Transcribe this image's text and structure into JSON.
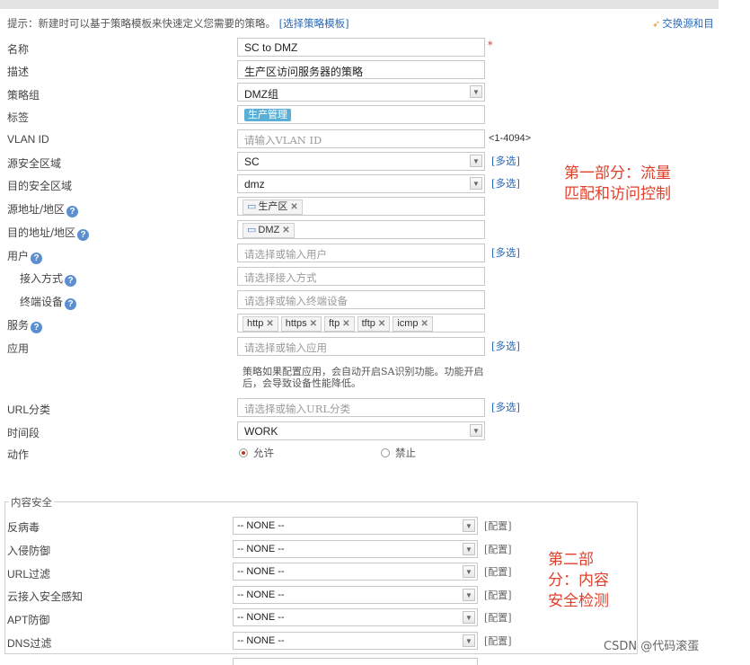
{
  "tip": {
    "text": "提示：新建时可以基于策略模板来快速定义您需要的策略。",
    "link": "[选择策略模板]"
  },
  "swap_label": "交换源和目",
  "form": {
    "name": {
      "label": "名称",
      "value": "SC to DMZ",
      "required_mark": "*"
    },
    "description": {
      "label": "描述",
      "value": "生产区访问服务器的策略"
    },
    "policy_group": {
      "label": "策略组",
      "value": "DMZ组"
    },
    "tags": {
      "label": "标签",
      "value": "生产管理"
    },
    "vlan": {
      "label": "VLAN ID",
      "placeholder": "请输入VLAN ID",
      "range": "<1-4094>"
    },
    "src_zone": {
      "label": "源安全区域",
      "value": "SC",
      "multi": "[多选]"
    },
    "dst_zone": {
      "label": "目的安全区域",
      "value": "dmz",
      "multi": "[多选]"
    },
    "src_addr": {
      "label": "源地址/地区",
      "chip": "生产区"
    },
    "dst_addr": {
      "label": "目的地址/地区",
      "chip": "DMZ"
    },
    "user": {
      "label": "用户",
      "placeholder": "请选择或输入用户",
      "multi": "[多选]"
    },
    "access_mode": {
      "label": "接入方式",
      "placeholder": "请选择接入方式"
    },
    "terminal": {
      "label": "终端设备",
      "placeholder": "请选择或输入终端设备"
    },
    "service": {
      "label": "服务",
      "chips": [
        "http",
        "https",
        "ftp",
        "tftp",
        "icmp"
      ]
    },
    "application": {
      "label": "应用",
      "placeholder": "请选择或输入应用",
      "multi": "[多选]",
      "note": "策略如果配置应用，会自动开启SA识别功能。功能开启后，会导致设备性能降低。"
    },
    "url_category": {
      "label": "URL分类",
      "placeholder": "请选择或输入URL分类",
      "multi": "[多选]"
    },
    "time_range": {
      "label": "时间段",
      "value": "WORK"
    },
    "action": {
      "label": "动作",
      "allow": "允许",
      "deny": "禁止"
    }
  },
  "annotation_1": [
    "第一部分：流量",
    "匹配和访问控制"
  ],
  "annotation_2": [
    "第二部",
    "分：内容",
    "安全检测"
  ],
  "content_security": {
    "legend": "内容安全",
    "rows": [
      {
        "label": "反病毒",
        "value": "-- NONE --",
        "config": "[配置]"
      },
      {
        "label": "入侵防御",
        "value": "-- NONE --",
        "config": "[配置]"
      },
      {
        "label": "URL过滤",
        "value": "-- NONE --",
        "config": "[配置]"
      },
      {
        "label": "云接入安全感知",
        "value": "-- NONE --",
        "config": "[配置]"
      },
      {
        "label": "APT防御",
        "value": "-- NONE --",
        "config": "[配置]"
      },
      {
        "label": "DNS过滤",
        "value": "-- NONE --",
        "config": "[配置]"
      }
    ]
  },
  "watermark": "CSDN @代码滚蛋"
}
